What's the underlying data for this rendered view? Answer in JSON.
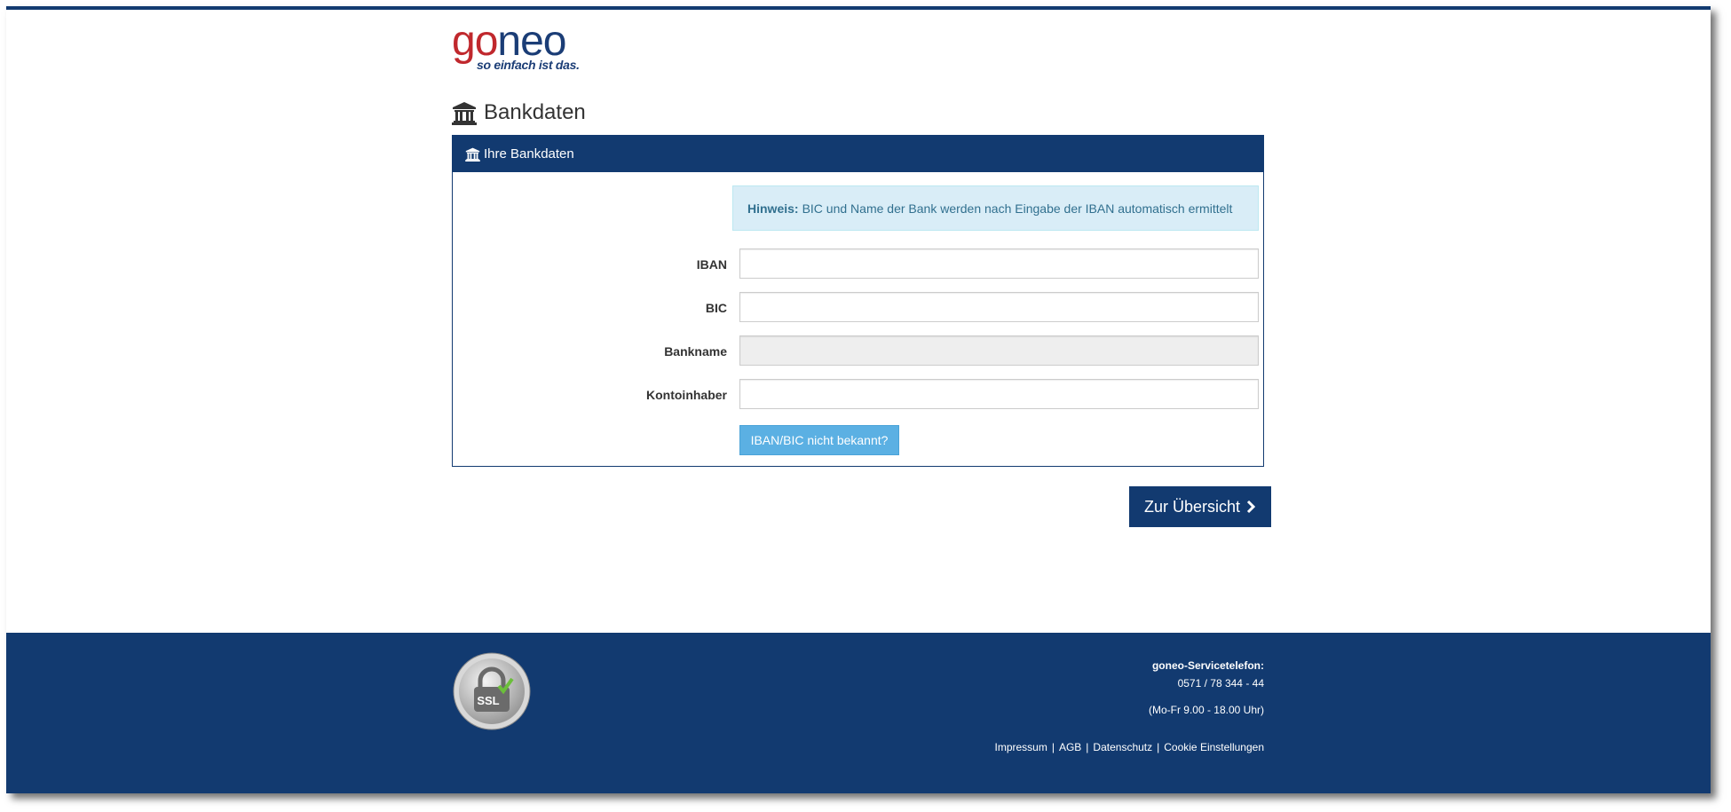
{
  "brand": {
    "logo_go": "go",
    "logo_neo": "neo",
    "tagline": "so einfach ist das.",
    "primary_color": "#123a70",
    "logo_red": "#c0282d"
  },
  "page": {
    "title": "Bankdaten",
    "title_icon": "bank-icon"
  },
  "panel": {
    "header": "Ihre Bankdaten",
    "notice": {
      "label": "Hinweis:",
      "text": "BIC und Name der Bank werden nach Eingabe der IBAN automatisch ermittelt"
    },
    "fields": {
      "iban": {
        "label": "IBAN",
        "value": ""
      },
      "bic": {
        "label": "BIC",
        "value": ""
      },
      "bankname": {
        "label": "Bankname",
        "value": "",
        "readonly": true
      },
      "kontoinhaber": {
        "label": "Kontoinhaber",
        "value": ""
      }
    },
    "help_button": "IBAN/BIC nicht bekannt?"
  },
  "actions": {
    "next_button": "Zur Übersicht",
    "next_icon": "chevron-right-icon"
  },
  "footer": {
    "ssl_badge": "SSL",
    "service_title": "goneo-Servicetelefon:",
    "service_phone": "0571 / 78 344 - 44",
    "service_hours": "(Mo-Fr 9.00 - 18.00 Uhr)",
    "links": [
      "Impressum",
      "AGB",
      "Datenschutz",
      "Cookie Einstellungen"
    ],
    "separator": "|"
  }
}
